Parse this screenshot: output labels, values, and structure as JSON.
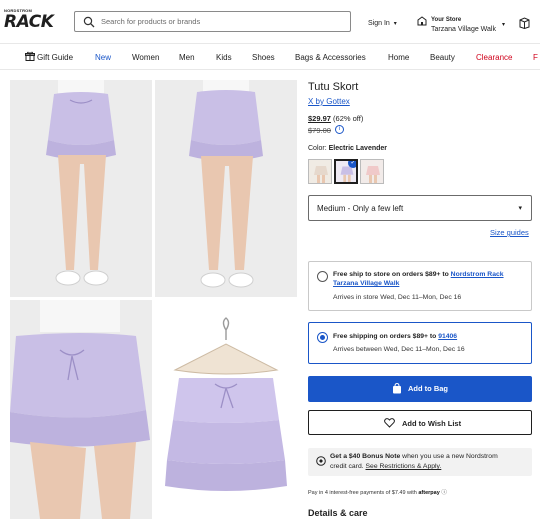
{
  "header": {
    "logo_small": "NORDSTROM",
    "logo_big": "RACK",
    "search_placeholder": "Search for products or brands",
    "signin_label": "Sign In",
    "store_label": "Your Store",
    "store_name": "Tarzana Village Walk"
  },
  "nav": {
    "items": [
      "Gift Guide",
      "New",
      "Women",
      "Men",
      "Kids",
      "Shoes",
      "Bags & Accessories",
      "Home",
      "Beauty",
      "Clearance",
      "F"
    ]
  },
  "product": {
    "title": "Tutu Skort",
    "brand": "X by Gottex",
    "price": "$29.97",
    "discount": "(62% off)",
    "original_price": "$79.00",
    "color_label": "Color:",
    "color_value": "Electric Lavender",
    "size_value": "Medium - Only a few left",
    "size_guides": "Size guides"
  },
  "shipping": {
    "store_option": {
      "prefix": "Free ship to store on orders $89+ to ",
      "store_link": "Nordstrom Rack Tarzana Village Walk",
      "arrival": "Arrives in store Wed, Dec 11–Mon, Dec 16"
    },
    "home_option": {
      "prefix": "Free shipping on orders $89+ to ",
      "zip_link": "91406",
      "arrival": "Arrives between Wed, Dec 11–Mon, Dec 16"
    }
  },
  "actions": {
    "add_to_bag": "Add to Bag",
    "add_to_wishlist": "Add to Wish List"
  },
  "bonus": {
    "bold": "Get a $40 Bonus Note",
    "rest": " when you use a new Nordstrom",
    "line2_prefix": "credit card. ",
    "line2_link": "See Restrictions & Apply."
  },
  "payment": {
    "text": "Pay in 4 interest-free payments of $7.49 with ",
    "brand": "afterpay",
    "info": "ⓘ"
  },
  "details_heading": "Details & care",
  "colors": {
    "accent": "#1a56c8",
    "lavender": "#c9bfe6",
    "clearance": "#d0021b"
  }
}
